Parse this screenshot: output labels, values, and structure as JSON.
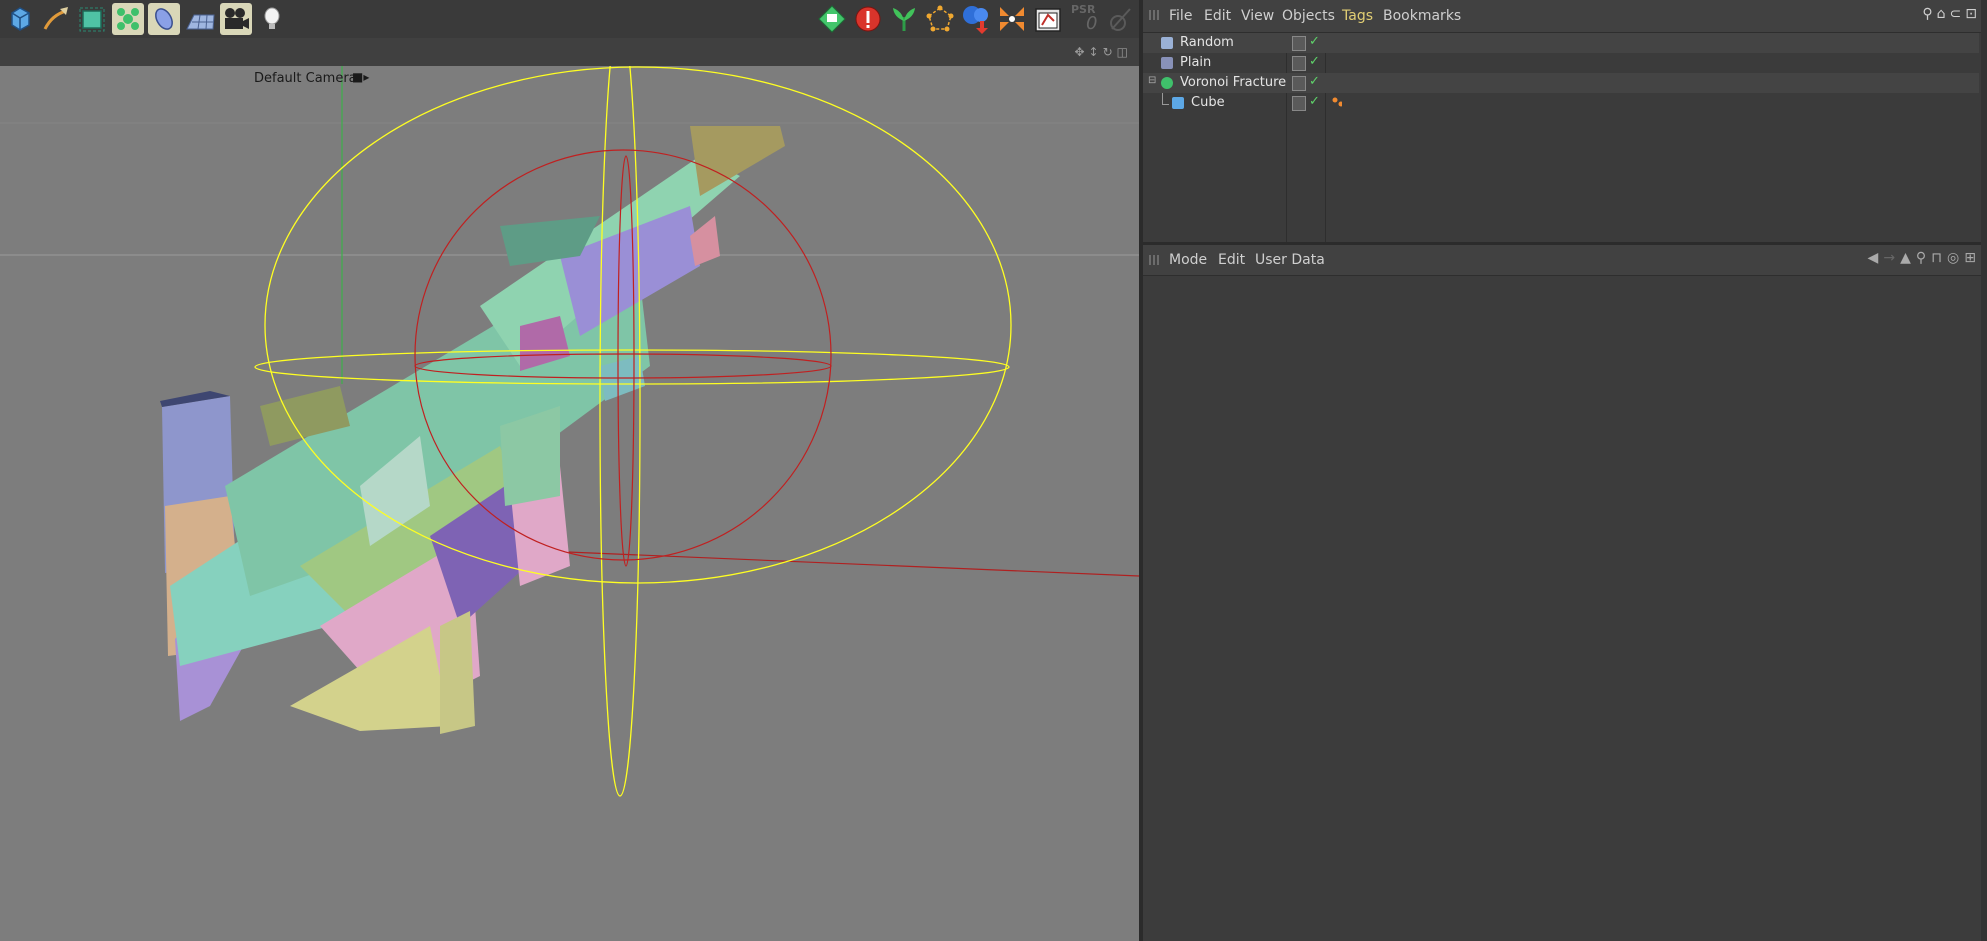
{
  "toolbar": {
    "left_tools": [
      {
        "name": "cube-icon",
        "color": "#5da8e6",
        "active": false
      },
      {
        "name": "pen-spline-icon",
        "color": "#e09a3a",
        "active": false
      },
      {
        "name": "subdivision-icon",
        "color": "#4fc2a5",
        "active": false
      },
      {
        "name": "mograph-cloner-icon",
        "color": "#3fc06b",
        "active": true
      },
      {
        "name": "deformer-icon",
        "color": "#8aa0e6",
        "active": true
      },
      {
        "name": "floor-scene-icon",
        "color": "#9fb6e0",
        "active": false
      },
      {
        "name": "camera-icon",
        "color": "#2a2a2a",
        "active": true
      },
      {
        "name": "light-icon",
        "color": "#f0f0f0",
        "active": false
      }
    ],
    "right_tools": [
      {
        "name": "render-region-icon",
        "color": "#43c56b"
      },
      {
        "name": "stop-icon",
        "color": "#d9342b"
      },
      {
        "name": "sketch-plant-icon",
        "color": "#41c25a"
      },
      {
        "name": "points-mode-icon",
        "color": "#f0a830"
      },
      {
        "name": "render-to-picture-icon",
        "color": "#2f6fd8"
      },
      {
        "name": "snap-icon",
        "color": "#f08a30"
      },
      {
        "name": "render-settings-icon",
        "color": "#e6e6e6"
      }
    ],
    "psr_label": "PSR",
    "psr_value": "0"
  },
  "viewport": {
    "camera_label": "Default Camera"
  },
  "object_manager": {
    "menu": [
      "File",
      "Edit",
      "View",
      "Objects",
      "Tags",
      "Bookmarks"
    ],
    "active_menu": "Tags",
    "objects": [
      {
        "name": "Random",
        "icon_color": "#9ab1d6",
        "indent": 0,
        "has_tag": false
      },
      {
        "name": "Plain",
        "icon_color": "#8891b8",
        "indent": 0,
        "has_tag": false
      },
      {
        "name": "Voronoi Fracture",
        "icon_color": "#3fc06b",
        "indent": 0,
        "expanded": true,
        "has_tag": false
      },
      {
        "name": "Cube",
        "icon_color": "#5da8e6",
        "indent": 1,
        "has_tag": true
      }
    ]
  },
  "attribute_manager": {
    "menu": [
      "Mode",
      "Edit",
      "User Data"
    ]
  }
}
